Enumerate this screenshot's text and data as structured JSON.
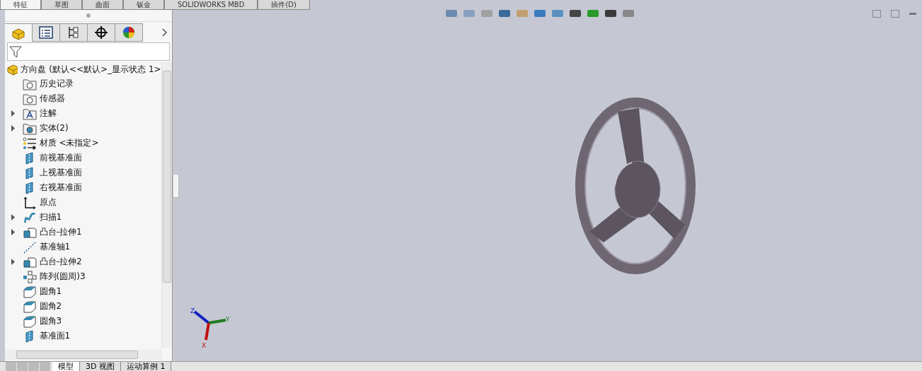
{
  "command_tabs": [
    {
      "label": "特征",
      "selected": true
    },
    {
      "label": "草图",
      "selected": false
    },
    {
      "label": "曲面",
      "selected": false
    },
    {
      "label": "钣金",
      "selected": false
    },
    {
      "label": "SOLIDWORKS MBD",
      "selected": false
    },
    {
      "label": "插件(D)",
      "selected": false
    }
  ],
  "panel_tabs": [
    {
      "kind": "feature",
      "selected": true
    },
    {
      "kind": "property",
      "selected": false
    },
    {
      "kind": "config",
      "selected": false
    },
    {
      "kind": "dim",
      "selected": false
    },
    {
      "kind": "display",
      "selected": false
    }
  ],
  "tree": {
    "root": "方向盘  (默认<<默认>_显示状态 1>",
    "items": [
      {
        "label": "历史记录",
        "kind": "history",
        "expandable": false
      },
      {
        "label": "传感器",
        "kind": "sensor",
        "expandable": false
      },
      {
        "label": "注解",
        "kind": "annotation",
        "expandable": true
      },
      {
        "label": "实体(2)",
        "kind": "solid",
        "expandable": true
      },
      {
        "label": "材质 <未指定>",
        "kind": "material",
        "expandable": false
      },
      {
        "label": "前视基准面",
        "kind": "plane",
        "expandable": false
      },
      {
        "label": "上视基准面",
        "kind": "plane",
        "expandable": false
      },
      {
        "label": "右视基准面",
        "kind": "plane",
        "expandable": false
      },
      {
        "label": "原点",
        "kind": "origin",
        "expandable": false
      },
      {
        "label": "扫描1",
        "kind": "sweep",
        "expandable": true
      },
      {
        "label": "凸台-拉伸1",
        "kind": "extrude",
        "expandable": true
      },
      {
        "label": "基准轴1",
        "kind": "axis",
        "expandable": false
      },
      {
        "label": "凸台-拉伸2",
        "kind": "extrude",
        "expandable": true
      },
      {
        "label": "阵列(圆周)3",
        "kind": "pattern",
        "expandable": false
      },
      {
        "label": "圆角1",
        "kind": "fillet",
        "expandable": false
      },
      {
        "label": "圆角2",
        "kind": "fillet",
        "expandable": false
      },
      {
        "label": "圆角3",
        "kind": "fillet",
        "expandable": false
      },
      {
        "label": "基准面1",
        "kind": "plane",
        "expandable": false
      }
    ]
  },
  "triad": {
    "z": "Z",
    "y": "Y",
    "x": "X"
  },
  "bottom_tabs": [
    {
      "label": "模型",
      "selected": true
    },
    {
      "label": "3D 视图",
      "selected": false
    },
    {
      "label": "运动算例 1",
      "selected": false
    }
  ]
}
